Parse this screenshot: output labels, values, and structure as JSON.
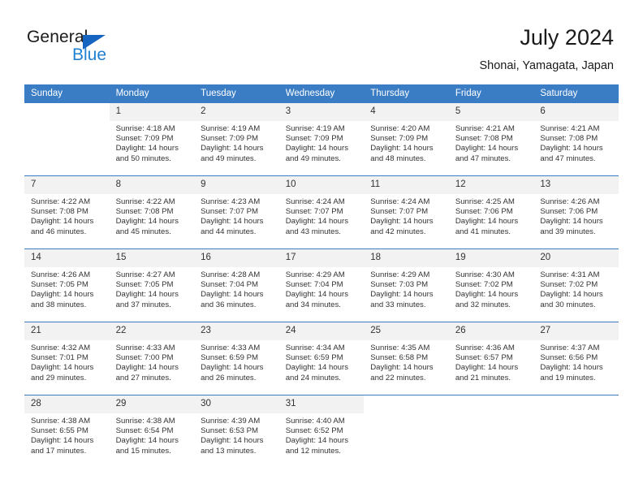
{
  "brand": {
    "line1": "General",
    "line2": "Blue",
    "triangle_color": "#1565c0",
    "blue_color": "#1f7fd0"
  },
  "header": {
    "title": "July 2024",
    "location": "Shonai, Yamagata, Japan"
  },
  "theme": {
    "header_row_bg": "#3b7dc4",
    "daynum_bg": "#f2f2f2",
    "text": "#333333"
  },
  "weekdays": [
    "Sunday",
    "Monday",
    "Tuesday",
    "Wednesday",
    "Thursday",
    "Friday",
    "Saturday"
  ],
  "labels": {
    "sunrise_prefix": "Sunrise:",
    "sunset_prefix": "Sunset:",
    "daylight_prefix": "Daylight:"
  },
  "weeks": [
    [
      {
        "empty": true
      },
      {
        "day": "1",
        "sunrise": "Sunrise: 4:18 AM",
        "sunset": "Sunset: 7:09 PM",
        "daylight1": "Daylight: 14 hours",
        "daylight2": "and 50 minutes."
      },
      {
        "day": "2",
        "sunrise": "Sunrise: 4:19 AM",
        "sunset": "Sunset: 7:09 PM",
        "daylight1": "Daylight: 14 hours",
        "daylight2": "and 49 minutes."
      },
      {
        "day": "3",
        "sunrise": "Sunrise: 4:19 AM",
        "sunset": "Sunset: 7:09 PM",
        "daylight1": "Daylight: 14 hours",
        "daylight2": "and 49 minutes."
      },
      {
        "day": "4",
        "sunrise": "Sunrise: 4:20 AM",
        "sunset": "Sunset: 7:09 PM",
        "daylight1": "Daylight: 14 hours",
        "daylight2": "and 48 minutes."
      },
      {
        "day": "5",
        "sunrise": "Sunrise: 4:21 AM",
        "sunset": "Sunset: 7:08 PM",
        "daylight1": "Daylight: 14 hours",
        "daylight2": "and 47 minutes."
      },
      {
        "day": "6",
        "sunrise": "Sunrise: 4:21 AM",
        "sunset": "Sunset: 7:08 PM",
        "daylight1": "Daylight: 14 hours",
        "daylight2": "and 47 minutes."
      }
    ],
    [
      {
        "day": "7",
        "sunrise": "Sunrise: 4:22 AM",
        "sunset": "Sunset: 7:08 PM",
        "daylight1": "Daylight: 14 hours",
        "daylight2": "and 46 minutes."
      },
      {
        "day": "8",
        "sunrise": "Sunrise: 4:22 AM",
        "sunset": "Sunset: 7:08 PM",
        "daylight1": "Daylight: 14 hours",
        "daylight2": "and 45 minutes."
      },
      {
        "day": "9",
        "sunrise": "Sunrise: 4:23 AM",
        "sunset": "Sunset: 7:07 PM",
        "daylight1": "Daylight: 14 hours",
        "daylight2": "and 44 minutes."
      },
      {
        "day": "10",
        "sunrise": "Sunrise: 4:24 AM",
        "sunset": "Sunset: 7:07 PM",
        "daylight1": "Daylight: 14 hours",
        "daylight2": "and 43 minutes."
      },
      {
        "day": "11",
        "sunrise": "Sunrise: 4:24 AM",
        "sunset": "Sunset: 7:07 PM",
        "daylight1": "Daylight: 14 hours",
        "daylight2": "and 42 minutes."
      },
      {
        "day": "12",
        "sunrise": "Sunrise: 4:25 AM",
        "sunset": "Sunset: 7:06 PM",
        "daylight1": "Daylight: 14 hours",
        "daylight2": "and 41 minutes."
      },
      {
        "day": "13",
        "sunrise": "Sunrise: 4:26 AM",
        "sunset": "Sunset: 7:06 PM",
        "daylight1": "Daylight: 14 hours",
        "daylight2": "and 39 minutes."
      }
    ],
    [
      {
        "day": "14",
        "sunrise": "Sunrise: 4:26 AM",
        "sunset": "Sunset: 7:05 PM",
        "daylight1": "Daylight: 14 hours",
        "daylight2": "and 38 minutes."
      },
      {
        "day": "15",
        "sunrise": "Sunrise: 4:27 AM",
        "sunset": "Sunset: 7:05 PM",
        "daylight1": "Daylight: 14 hours",
        "daylight2": "and 37 minutes."
      },
      {
        "day": "16",
        "sunrise": "Sunrise: 4:28 AM",
        "sunset": "Sunset: 7:04 PM",
        "daylight1": "Daylight: 14 hours",
        "daylight2": "and 36 minutes."
      },
      {
        "day": "17",
        "sunrise": "Sunrise: 4:29 AM",
        "sunset": "Sunset: 7:04 PM",
        "daylight1": "Daylight: 14 hours",
        "daylight2": "and 34 minutes."
      },
      {
        "day": "18",
        "sunrise": "Sunrise: 4:29 AM",
        "sunset": "Sunset: 7:03 PM",
        "daylight1": "Daylight: 14 hours",
        "daylight2": "and 33 minutes."
      },
      {
        "day": "19",
        "sunrise": "Sunrise: 4:30 AM",
        "sunset": "Sunset: 7:02 PM",
        "daylight1": "Daylight: 14 hours",
        "daylight2": "and 32 minutes."
      },
      {
        "day": "20",
        "sunrise": "Sunrise: 4:31 AM",
        "sunset": "Sunset: 7:02 PM",
        "daylight1": "Daylight: 14 hours",
        "daylight2": "and 30 minutes."
      }
    ],
    [
      {
        "day": "21",
        "sunrise": "Sunrise: 4:32 AM",
        "sunset": "Sunset: 7:01 PM",
        "daylight1": "Daylight: 14 hours",
        "daylight2": "and 29 minutes."
      },
      {
        "day": "22",
        "sunrise": "Sunrise: 4:33 AM",
        "sunset": "Sunset: 7:00 PM",
        "daylight1": "Daylight: 14 hours",
        "daylight2": "and 27 minutes."
      },
      {
        "day": "23",
        "sunrise": "Sunrise: 4:33 AM",
        "sunset": "Sunset: 6:59 PM",
        "daylight1": "Daylight: 14 hours",
        "daylight2": "and 26 minutes."
      },
      {
        "day": "24",
        "sunrise": "Sunrise: 4:34 AM",
        "sunset": "Sunset: 6:59 PM",
        "daylight1": "Daylight: 14 hours",
        "daylight2": "and 24 minutes."
      },
      {
        "day": "25",
        "sunrise": "Sunrise: 4:35 AM",
        "sunset": "Sunset: 6:58 PM",
        "daylight1": "Daylight: 14 hours",
        "daylight2": "and 22 minutes."
      },
      {
        "day": "26",
        "sunrise": "Sunrise: 4:36 AM",
        "sunset": "Sunset: 6:57 PM",
        "daylight1": "Daylight: 14 hours",
        "daylight2": "and 21 minutes."
      },
      {
        "day": "27",
        "sunrise": "Sunrise: 4:37 AM",
        "sunset": "Sunset: 6:56 PM",
        "daylight1": "Daylight: 14 hours",
        "daylight2": "and 19 minutes."
      }
    ],
    [
      {
        "day": "28",
        "sunrise": "Sunrise: 4:38 AM",
        "sunset": "Sunset: 6:55 PM",
        "daylight1": "Daylight: 14 hours",
        "daylight2": "and 17 minutes."
      },
      {
        "day": "29",
        "sunrise": "Sunrise: 4:38 AM",
        "sunset": "Sunset: 6:54 PM",
        "daylight1": "Daylight: 14 hours",
        "daylight2": "and 15 minutes."
      },
      {
        "day": "30",
        "sunrise": "Sunrise: 4:39 AM",
        "sunset": "Sunset: 6:53 PM",
        "daylight1": "Daylight: 14 hours",
        "daylight2": "and 13 minutes."
      },
      {
        "day": "31",
        "sunrise": "Sunrise: 4:40 AM",
        "sunset": "Sunset: 6:52 PM",
        "daylight1": "Daylight: 14 hours",
        "daylight2": "and 12 minutes."
      },
      {
        "empty": true
      },
      {
        "empty": true
      },
      {
        "empty": true
      }
    ]
  ]
}
